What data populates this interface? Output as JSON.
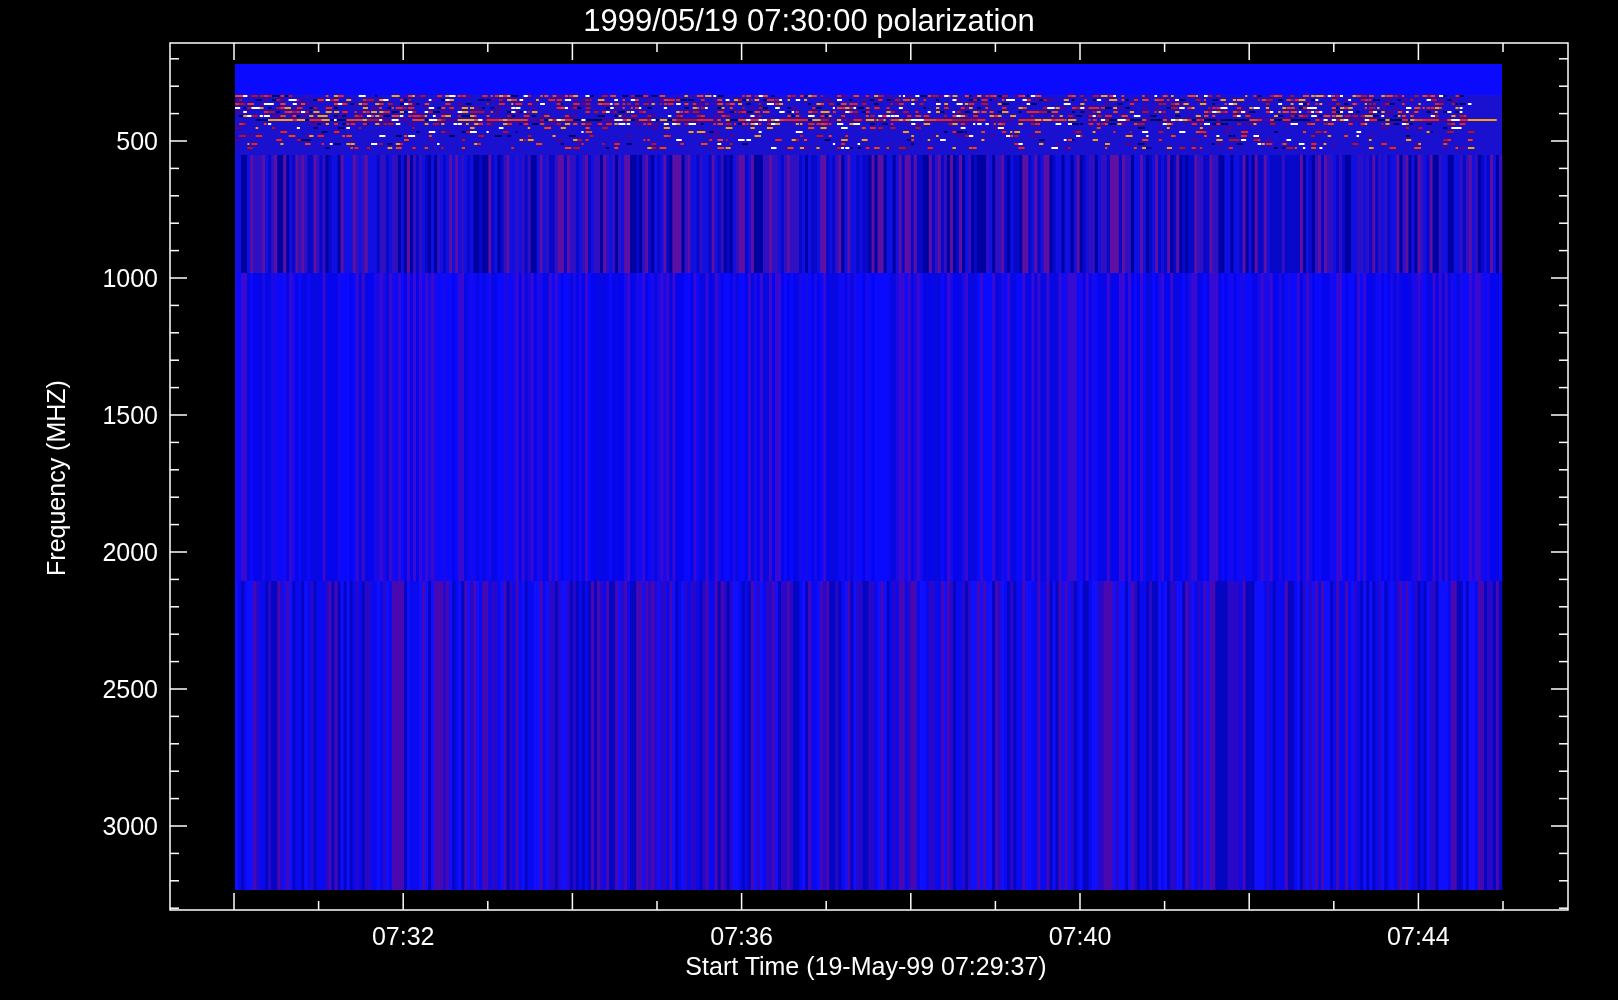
{
  "title": "1999/05/19 07:30:00 polarization",
  "y_axis": {
    "label": "Frequency (MHZ)",
    "ticks": [
      "500",
      "1000",
      "1500",
      "2000",
      "2500",
      "3000"
    ]
  },
  "x_axis": {
    "label": "Start Time (19-May-99 07:29:37)",
    "ticks": [
      "07:32",
      "07:36",
      "07:40",
      "07:44"
    ]
  }
}
